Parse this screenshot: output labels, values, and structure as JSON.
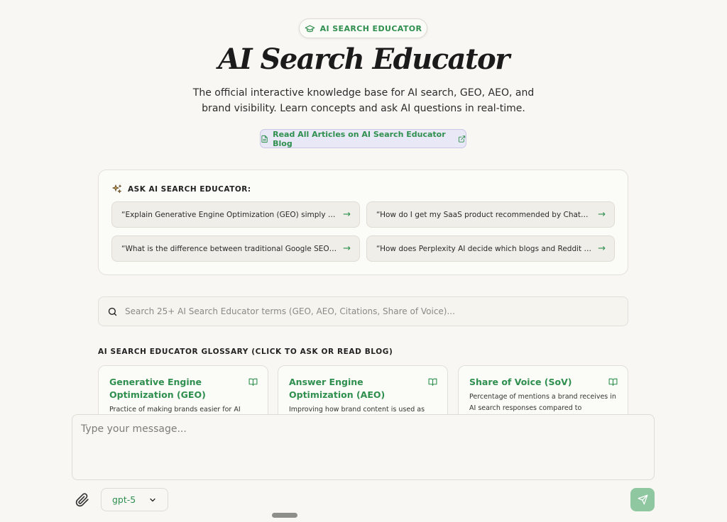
{
  "header": {
    "badge_label": "AI SEARCH EDUCATOR",
    "title": "AI Search Educator",
    "subtitle": "The official interactive knowledge base for AI search, GEO, AEO, and brand visibility. Learn concepts and ask AI questions in real-time.",
    "blog_link": "Read All Articles on AI Search Educator Blog"
  },
  "ask": {
    "heading": "ASK AI SEARCH EDUCATOR:",
    "suggestions": [
      "“Explain Generative Engine Optimization (GEO) simply for be…",
      "“How do I get my SaaS product recommended by ChatGPT?”",
      "“What is the difference between traditional Google SEO and …",
      "“How does Perplexity AI decide which blogs and Reddit thre…"
    ]
  },
  "search": {
    "placeholder": "Search 25+ AI Search Educator terms (GEO, AEO, Citations, Share of Voice)..."
  },
  "glossary": {
    "heading": "AI SEARCH EDUCATOR GLOSSARY (CLICK TO ASK OR READ BLOG)",
    "terms": [
      {
        "name": "Generative Engine Optimization (GEO)",
        "desc": "Practice of making brands easier for AI"
      },
      {
        "name": "Answer Engine Optimization (AEO)",
        "desc": "Improving how brand content is used as"
      },
      {
        "name": "Share of Voice (SoV)",
        "desc": "Percentage of mentions a brand receives in AI search responses compared to competitors."
      }
    ]
  },
  "composer": {
    "placeholder": "Type your message...",
    "model": "gpt-5"
  },
  "colors": {
    "accent": "#2f8f4e",
    "background": "#f8f7f3",
    "send_button": "#8fc7a0"
  }
}
